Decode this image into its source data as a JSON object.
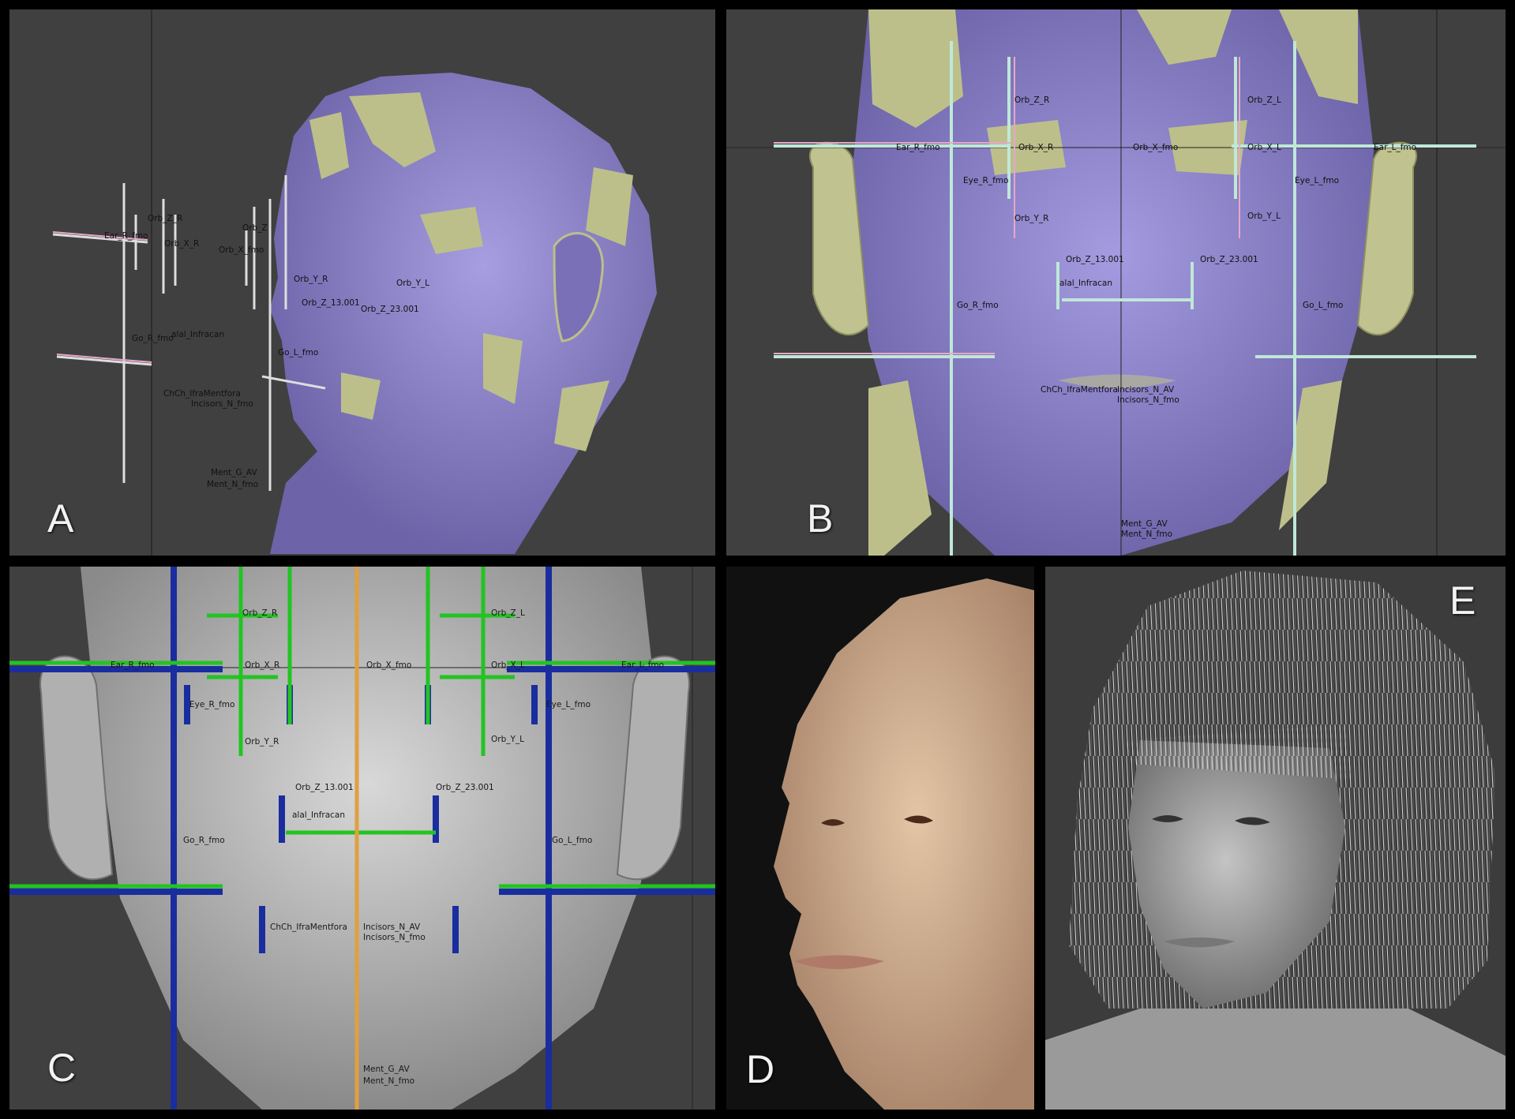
{
  "panels": {
    "A": {
      "letter": "A",
      "labels": [
        "Orb_Z_R",
        "Ear_R_fmo",
        "Orb_X_R",
        "Orb_X_fmo",
        "Orb_Z",
        "Orb_Y_R",
        "Orb_Y_L",
        "Orb_Z_13.001",
        "Orb_Z_23.001",
        "Go_R_fmo",
        "alal_Infracan",
        "Go_L_fmo",
        "ChCh_IfraMentfora",
        "Incisors_N_fmo",
        "Ment_G_AV",
        "Ment_N_fmo"
      ]
    },
    "B": {
      "letter": "B",
      "labels": [
        "Orb_Z_R",
        "Orb_Z_L",
        "Ear_R_fmo",
        "Orb_X_R",
        "Orb_X_fmo",
        "Orb_X_L",
        "Ear_L_fmo",
        "Eye_R_fmo",
        "Eye_L_fmo",
        "Orb_Y_R",
        "Orb_Y_L",
        "Orb_Z_13.001",
        "Orb_Z_23.001",
        "alal_Infracan",
        "Go_R_fmo",
        "Go_L_fmo",
        "ChCh_IfraMentfora",
        "Incisors_N_AV",
        "Incisors_N_fmo",
        "Ment_G_AV",
        "Ment_N_fmo"
      ]
    },
    "C": {
      "letter": "C",
      "labels": [
        "Orb_Z_R",
        "Orb_Z_L",
        "Ear_R_fmo",
        "Orb_X_R",
        "Orb_X_fmo",
        "Orb_X_L",
        "Ear_L_fmo",
        "Eye_R_fmo",
        "Eye_L_fmo",
        "Orb_Y_R",
        "Orb_Y_L",
        "Orb_Z_13.001",
        "Orb_Z_23.001",
        "alal_Infracan",
        "Go_R_fmo",
        "Go_L_fmo",
        "ChCh_IfraMentfora",
        "Incisors_N_AV",
        "Incisors_N_fmo",
        "Ment_G_AV",
        "Ment_N_fmo"
      ]
    },
    "D": {
      "letter": "D"
    },
    "E": {
      "letter": "E"
    }
  },
  "colors": {
    "viewport_bg": "#404040",
    "frame": "#000000",
    "purple_skin": "#8e84c6",
    "tissue_yellow": "#bdbf8a",
    "clay_gray": "#9c9c9c",
    "guide_blue": "#1a2d9e",
    "guide_green": "#22c422",
    "guide_orange": "#e0a040"
  }
}
